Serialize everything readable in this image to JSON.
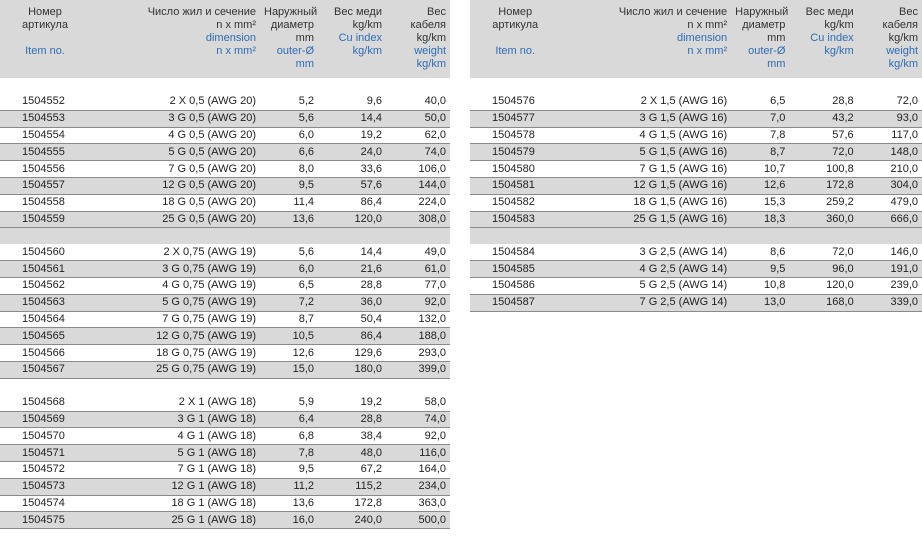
{
  "header": {
    "item_ru": [
      "Номер",
      "артикула"
    ],
    "item_en": [
      "Item no."
    ],
    "dim_ru": [
      "Число жил и сечение",
      "n x mm²"
    ],
    "dim_en": [
      "dimension",
      "n x mm²"
    ],
    "od_ru": [
      "Наружный",
      "диаметр",
      "mm"
    ],
    "od_en": [
      "outer-Ø",
      "mm"
    ],
    "cu_ru": [
      "Вес меди",
      "kg/km"
    ],
    "cu_en": [
      "Cu index",
      "kg/km"
    ],
    "wt_ru": [
      "Вес",
      "кабеля",
      "kg/km"
    ],
    "wt_en": [
      "weight",
      "kg/km"
    ]
  },
  "left_groups": [
    [
      [
        "1504552",
        "2 X 0,5 (AWG 20)",
        "5,2",
        "9,6",
        "40,0"
      ],
      [
        "1504553",
        "3 G 0,5 (AWG 20)",
        "5,6",
        "14,4",
        "50,0"
      ],
      [
        "1504554",
        "4 G 0,5 (AWG 20)",
        "6,0",
        "19,2",
        "62,0"
      ],
      [
        "1504555",
        "5 G 0,5 (AWG 20)",
        "6,6",
        "24,0",
        "74,0"
      ],
      [
        "1504556",
        "7 G 0,5 (AWG 20)",
        "8,0",
        "33,6",
        "106,0"
      ],
      [
        "1504557",
        "12 G 0,5 (AWG 20)",
        "9,5",
        "57,6",
        "144,0"
      ],
      [
        "1504558",
        "18 G 0,5 (AWG 20)",
        "11,4",
        "86,4",
        "224,0"
      ],
      [
        "1504559",
        "25 G 0,5 (AWG 20)",
        "13,6",
        "120,0",
        "308,0"
      ]
    ],
    [
      [
        "1504560",
        "2 X 0,75 (AWG 19)",
        "5,6",
        "14,4",
        "49,0"
      ],
      [
        "1504561",
        "3 G 0,75 (AWG 19)",
        "6,0",
        "21,6",
        "61,0"
      ],
      [
        "1504562",
        "4 G 0,75 (AWG 19)",
        "6,5",
        "28,8",
        "77,0"
      ],
      [
        "1504563",
        "5 G 0,75 (AWG 19)",
        "7,2",
        "36,0",
        "92,0"
      ],
      [
        "1504564",
        "7 G 0,75 (AWG 19)",
        "8,7",
        "50,4",
        "132,0"
      ],
      [
        "1504565",
        "12 G 0,75 (AWG 19)",
        "10,5",
        "86,4",
        "188,0"
      ],
      [
        "1504566",
        "18 G 0,75 (AWG 19)",
        "12,6",
        "129,6",
        "293,0"
      ],
      [
        "1504567",
        "25 G 0,75 (AWG 19)",
        "15,0",
        "180,0",
        "399,0"
      ]
    ],
    [
      [
        "1504568",
        "2 X 1 (AWG 18)",
        "5,9",
        "19,2",
        "58,0"
      ],
      [
        "1504569",
        "3 G 1 (AWG 18)",
        "6,4",
        "28,8",
        "74,0"
      ],
      [
        "1504570",
        "4 G 1 (AWG 18)",
        "6,8",
        "38,4",
        "92,0"
      ],
      [
        "1504571",
        "5 G 1 (AWG 18)",
        "7,8",
        "48,0",
        "116,0"
      ],
      [
        "1504572",
        "7 G 1 (AWG 18)",
        "9,5",
        "67,2",
        "164,0"
      ],
      [
        "1504573",
        "12 G 1 (AWG 18)",
        "11,2",
        "115,2",
        "234,0"
      ],
      [
        "1504574",
        "18 G 1 (AWG 18)",
        "13,6",
        "172,8",
        "363,0"
      ],
      [
        "1504575",
        "25 G 1 (AWG 18)",
        "16,0",
        "240,0",
        "500,0"
      ]
    ]
  ],
  "right_groups": [
    [
      [
        "1504576",
        "2 X 1,5 (AWG 16)",
        "6,5",
        "28,8",
        "72,0"
      ],
      [
        "1504577",
        "3 G 1,5 (AWG 16)",
        "7,0",
        "43,2",
        "93,0"
      ],
      [
        "1504578",
        "4 G 1,5 (AWG 16)",
        "7,8",
        "57,6",
        "117,0"
      ],
      [
        "1504579",
        "5 G 1,5 (AWG 16)",
        "8,7",
        "72,0",
        "148,0"
      ],
      [
        "1504580",
        "7 G 1,5 (AWG 16)",
        "10,7",
        "100,8",
        "210,0"
      ],
      [
        "1504581",
        "12 G 1,5 (AWG 16)",
        "12,6",
        "172,8",
        "304,0"
      ],
      [
        "1504582",
        "18 G 1,5 (AWG 16)",
        "15,3",
        "259,2",
        "479,0"
      ],
      [
        "1504583",
        "25 G 1,5 (AWG 16)",
        "18,3",
        "360,0",
        "666,0"
      ]
    ],
    [
      [
        "1504584",
        "3 G 2,5 (AWG 14)",
        "8,6",
        "72,0",
        "146,0"
      ],
      [
        "1504585",
        "4 G 2,5 (AWG 14)",
        "9,5",
        "96,0",
        "191,0"
      ],
      [
        "1504586",
        "5 G 2,5 (AWG 14)",
        "10,8",
        "120,0",
        "239,0"
      ],
      [
        "1504587",
        "7 G 2,5 (AWG 14)",
        "13,0",
        "168,0",
        "339,0"
      ]
    ]
  ]
}
